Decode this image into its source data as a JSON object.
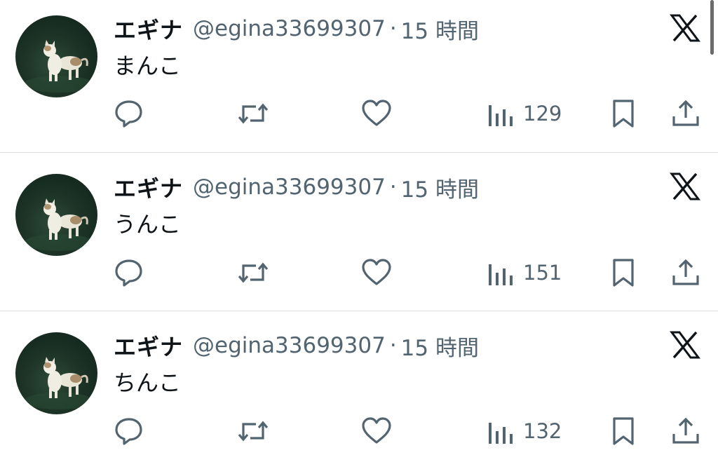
{
  "tweets": [
    {
      "display_name": "エギナ",
      "handle": "@egina33699307",
      "separator": "·",
      "time": "15 時間",
      "text": "まんこ",
      "views": "129",
      "icons": [
        "reply-icon",
        "retweet-icon",
        "like-icon",
        "views-icon",
        "bookmark-icon",
        "share-icon",
        "x-logo-icon"
      ]
    },
    {
      "display_name": "エギナ",
      "handle": "@egina33699307",
      "separator": "·",
      "time": "15 時間",
      "text": "うんこ",
      "views": "151",
      "icons": [
        "reply-icon",
        "retweet-icon",
        "like-icon",
        "views-icon",
        "bookmark-icon",
        "share-icon",
        "x-logo-icon"
      ]
    },
    {
      "display_name": "エギナ",
      "handle": "@egina33699307",
      "separator": "·",
      "time": "15 時間",
      "text": "ちんこ",
      "views": "132",
      "icons": [
        "reply-icon",
        "retweet-icon",
        "like-icon",
        "views-icon",
        "bookmark-icon",
        "share-icon",
        "x-logo-icon"
      ]
    }
  ],
  "colors": {
    "text_primary": "#0f1419",
    "text_secondary": "#536471",
    "divider": "#dcdfe3",
    "avatar_bg": "#1c3326"
  }
}
